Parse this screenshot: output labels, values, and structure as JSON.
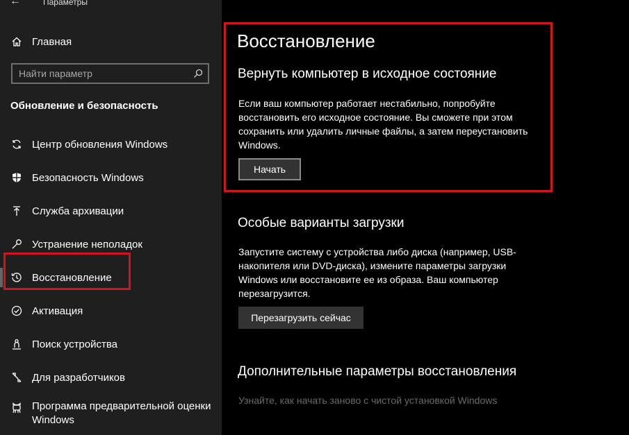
{
  "window": {
    "title": "Параметры",
    "back_glyph": "←"
  },
  "sidebar": {
    "home_label": "Главная",
    "search_placeholder": "Найти параметр",
    "section_title": "Обновление и безопасность",
    "items": [
      {
        "label": "Центр обновления Windows",
        "icon": "sync-icon"
      },
      {
        "label": "Безопасность Windows",
        "icon": "shield-icon"
      },
      {
        "label": "Служба архивации",
        "icon": "backup-arrow-icon"
      },
      {
        "label": "Устранение неполадок",
        "icon": "wrench-icon"
      },
      {
        "label": "Восстановление",
        "icon": "history-icon",
        "selected": true
      },
      {
        "label": "Активация",
        "icon": "check-circle-icon"
      },
      {
        "label": "Поиск устройства",
        "icon": "person-location-icon"
      },
      {
        "label": "Для разработчиков",
        "icon": "developer-tools-icon"
      },
      {
        "label": "Программа предварительной оценки Windows",
        "icon": "insider-cat-icon"
      }
    ]
  },
  "main": {
    "page_title": "Восстановление",
    "reset": {
      "heading": "Вернуть компьютер в исходное состояние",
      "description": "Если ваш компьютер работает нестабильно, попробуйте восстановить его исходное состояние. Вы сможете при этом сохранить или удалить личные файлы, а затем переустановить Windows.",
      "button_label": "Начать"
    },
    "advanced_startup": {
      "heading": "Особые варианты загрузки",
      "description": "Запустите систему с устройства либо диска (например, USB-накопителя или DVD-диска), измените параметры загрузки Windows или восстановите ее из образа. Ваш компьютер перезагрузится.",
      "button_label": "Перезагрузить сейчас"
    },
    "more_options": {
      "heading": "Дополнительные параметры восстановления",
      "link_text": "Узнайте, как начать заново с чистой установкой Windows"
    }
  },
  "colors": {
    "sidebar_bg": "#1f1f1f",
    "main_bg": "#000000",
    "highlight_red": "#d3131d",
    "button_bg": "#333333",
    "dim_text": "#6a6a6a"
  }
}
